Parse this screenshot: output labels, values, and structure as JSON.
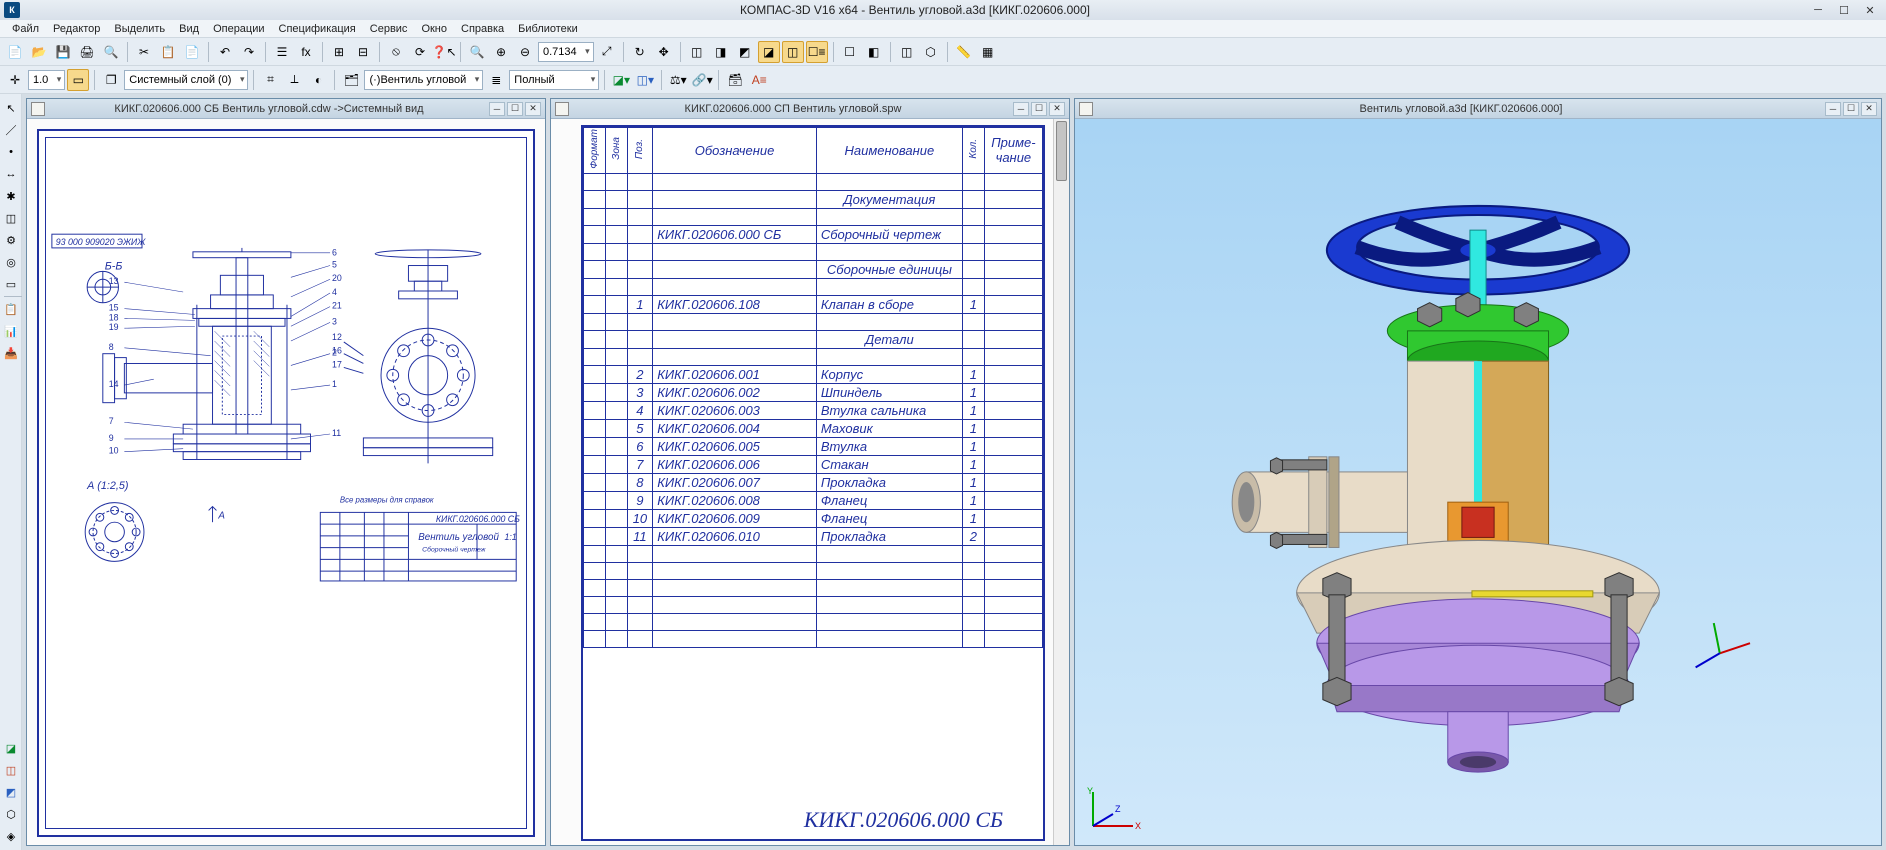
{
  "titlebar": {
    "title": "КОМПАС-3D V16  x64 - Вентиль угловой.a3d [КИКГ.020606.000]"
  },
  "menu": [
    "Файл",
    "Редактор",
    "Выделить",
    "Вид",
    "Операции",
    "Спецификация",
    "Сервис",
    "Окно",
    "Справка",
    "Библиотеки"
  ],
  "toolbar1": {
    "zoom_value": "0.7134",
    "linewidth": "1.0",
    "layer_combo": "Системный слой (0)",
    "view_combo": "(·)Вентиль угловой",
    "display_combo": "Полный"
  },
  "doc_left": {
    "title": "КИКГ.020606.000 СБ Вентиль угловой.cdw ->Системный вид",
    "frame_code_top": "93 000 909020 ЭЖИЖ",
    "titleblock_code": "КИКГ.020606.000 СБ",
    "titleblock_name": "Вентиль угловой",
    "titleblock_sub": "Сборочный чертеж",
    "scale_label": "А (1:2,5)",
    "section_label": "Б-Б",
    "scale_num": "1:1",
    "dims_note": "Все размеры для справок"
  },
  "doc_mid": {
    "title": "КИКГ.020606.000 СП Вентиль  угловой.spw",
    "headers": {
      "format": "Формат",
      "zone": "Зона",
      "pos": "Поз.",
      "designation": "Обозначение",
      "name": "Наименование",
      "qty": "Кол.",
      "note": "Приме-\nчание"
    },
    "sections": [
      {
        "heading": "Документация",
        "rows": [
          {
            "pos": "",
            "des": "КИКГ.020606.000 СБ",
            "name": "Сборочный чертеж",
            "qty": ""
          }
        ]
      },
      {
        "heading": "Сборочные единицы",
        "rows": [
          {
            "pos": "1",
            "des": "КИКГ.020606.108",
            "name": "Клапан в сборе",
            "qty": "1"
          }
        ]
      },
      {
        "heading": "Детали",
        "rows": [
          {
            "pos": "2",
            "des": "КИКГ.020606.001",
            "name": "Корпус",
            "qty": "1"
          },
          {
            "pos": "3",
            "des": "КИКГ.020606.002",
            "name": "Шпиндель",
            "qty": "1"
          },
          {
            "pos": "4",
            "des": "КИКГ.020606.003",
            "name": "Втулка сальника",
            "qty": "1"
          },
          {
            "pos": "5",
            "des": "КИКГ.020606.004",
            "name": "Маховик",
            "qty": "1"
          },
          {
            "pos": "6",
            "des": "КИКГ.020606.005",
            "name": "Втулка",
            "qty": "1"
          },
          {
            "pos": "7",
            "des": "КИКГ.020606.006",
            "name": "Стакан",
            "qty": "1"
          },
          {
            "pos": "8",
            "des": "КИКГ.020606.007",
            "name": "Прокладка",
            "qty": "1"
          },
          {
            "pos": "9",
            "des": "КИКГ.020606.008",
            "name": "Фланец",
            "qty": "1"
          },
          {
            "pos": "10",
            "des": "КИКГ.020606.009",
            "name": "Фланец",
            "qty": "1"
          },
          {
            "pos": "11",
            "des": "КИКГ.020606.010",
            "name": "Прокладка",
            "qty": "2"
          }
        ]
      }
    ],
    "footer_code": "КИКГ.020606.000 СБ"
  },
  "doc_right": {
    "title": "Вентиль угловой.a3d [КИКГ.020606.000]"
  }
}
